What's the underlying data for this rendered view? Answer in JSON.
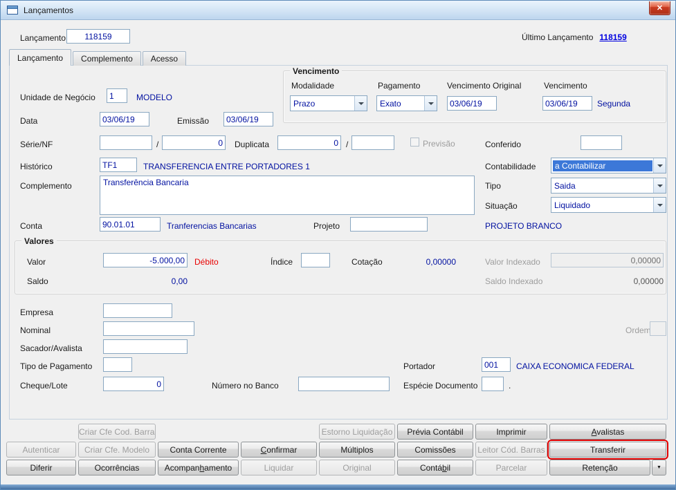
{
  "window": {
    "title": "Lançamentos",
    "close_glyph": "✕"
  },
  "header": {
    "label": "Lançamento",
    "value": "118159",
    "last_label": "Último Lançamento",
    "last_value": "118159"
  },
  "tabs": [
    {
      "label": "Lançamento",
      "active": true
    },
    {
      "label": "Complemento",
      "active": false
    },
    {
      "label": "Acesso",
      "active": false
    }
  ],
  "main": {
    "unidade_label": "Unidade de Negócio",
    "unidade_value": "1",
    "unidade_desc": "MODELO",
    "venc": {
      "title": "Vencimento",
      "modalidade_label": "Modalidade",
      "modalidade_value": "Prazo",
      "pagamento_label": "Pagamento",
      "pagamento_value": "Exato",
      "venc_orig_label": "Vencimento Original",
      "venc_orig_value": "03/06/19",
      "venc_label": "Vencimento",
      "venc_value": "03/06/19",
      "weekday": "Segunda"
    },
    "data_label": "Data",
    "data_value": "03/06/19",
    "emissao_label": "Emissão",
    "emissao_value": "03/06/19",
    "serie_label": "Série/NF",
    "serie_value": "",
    "serie_sep": "/",
    "serie_num": "0",
    "duplicata_label": "Duplicata",
    "duplicata_num": "0",
    "duplicata_sep": "/",
    "duplicata_value2": "",
    "previsao_label": "Previsão",
    "conferido_label": "Conferido",
    "conferido_value": "",
    "historico_label": "Histórico",
    "historico_value": "TF1",
    "historico_desc": "TRANSFERENCIA ENTRE PORTADORES 1",
    "contabilidade_label": "Contabilidade",
    "contabilidade_value": "a Contabilizar",
    "complemento_label": "Complemento",
    "complemento_value": "Transferência Bancaria",
    "tipo_label": "Tipo",
    "tipo_value": "Saida",
    "situacao_label": "Situação",
    "situacao_value": "Liquidado",
    "conta_label": "Conta",
    "conta_value": "90.01.01",
    "conta_desc": "Tranferencias Bancarias",
    "projeto_label": "Projeto",
    "projeto_value": "",
    "projeto_desc": "PROJETO BRANCO",
    "valores": {
      "title": "Valores",
      "valor_label": "Valor",
      "valor_value": "-5.000,00",
      "valor_flag": "Débito",
      "indice_label": "Índice",
      "indice_value": "",
      "cotacao_label": "Cotação",
      "cotacao_value": "0,00000",
      "valor_indexado_label": "Valor Indexado",
      "valor_indexado_value": "0,00000",
      "saldo_label": "Saldo",
      "saldo_value": "0,00",
      "saldo_indexado_label": "Saldo Indexado",
      "saldo_indexado_value": "0,00000"
    },
    "empresa_label": "Empresa",
    "empresa_value": "",
    "nominal_label": "Nominal",
    "nominal_value": "",
    "ordem_label": "Ordem",
    "sacador_label": "Sacador/Avalista",
    "sacador_value": "",
    "tipo_pagamento_label": "Tipo de Pagamento",
    "tipo_pagamento_value": "",
    "portador_label": "Portador",
    "portador_value": "001",
    "portador_desc": "CAIXA ECONOMICA FEDERAL",
    "cheque_label": "Cheque/Lote",
    "cheque_value": "0",
    "numero_banco_label": "Número no Banco",
    "numero_banco_value": "",
    "especie_label": "Espécie Documento",
    "especie_value": "",
    "especie_suffix": "."
  },
  "buttons": {
    "dropdown_glyph": "▼",
    "rows": [
      [
        null,
        {
          "pre": "Criar Cfe Cod. Barras",
          "mn": "",
          "post": "",
          "enabled": false
        },
        null,
        null,
        {
          "pre": "Estorno Liquidação",
          "mn": "",
          "post": "",
          "enabled": false
        },
        {
          "pre": "Prévia Contábil",
          "mn": "",
          "post": "",
          "enabled": true
        },
        {
          "pre": "Imprimir",
          "mn": "",
          "post": "",
          "enabled": true
        },
        {
          "pre": "",
          "mn": "A",
          "post": "valistas",
          "enabled": true
        }
      ],
      [
        {
          "pre": "Autenticar",
          "mn": "",
          "post": "",
          "enabled": false
        },
        {
          "pre": "Criar Cfe. Modelo",
          "mn": "",
          "post": "",
          "enabled": false
        },
        {
          "pre": "Conta Corrente",
          "mn": "",
          "post": "",
          "enabled": true
        },
        {
          "pre": "",
          "mn": "C",
          "post": "onfirmar",
          "enabled": true
        },
        {
          "pre": "Múltiplos",
          "mn": "",
          "post": "",
          "enabled": true
        },
        {
          "pre": "Comissões",
          "mn": "",
          "post": "",
          "enabled": true
        },
        {
          "pre": "Leitor Cód. Barras",
          "mn": "",
          "post": "",
          "enabled": false
        },
        {
          "pre": "Transferir",
          "mn": "",
          "post": "",
          "enabled": true,
          "highlighted": true
        }
      ],
      [
        {
          "pre": "Diferir",
          "mn": "",
          "post": "",
          "enabled": true
        },
        {
          "pre": "Ocorrências",
          "mn": "",
          "post": "",
          "enabled": true
        },
        {
          "pre": "Acompan",
          "mn": "h",
          "post": "amento",
          "enabled": true
        },
        {
          "pre": "Liquidar",
          "mn": "",
          "post": "",
          "enabled": false
        },
        {
          "pre": "Original",
          "mn": "",
          "post": "",
          "enabled": false
        },
        {
          "pre": "Contá",
          "mn": "b",
          "post": "il",
          "enabled": true
        },
        {
          "pre": "Parcelar",
          "mn": "",
          "post": "",
          "enabled": false
        },
        {
          "pre": "Retenção",
          "mn": "",
          "post": "",
          "enabled": true
        }
      ]
    ]
  },
  "colors": {
    "value": "#0010a0",
    "selection": "#3c78d8",
    "link": "#0000e0",
    "debit": "#e80000",
    "annotation": "#e00000"
  }
}
